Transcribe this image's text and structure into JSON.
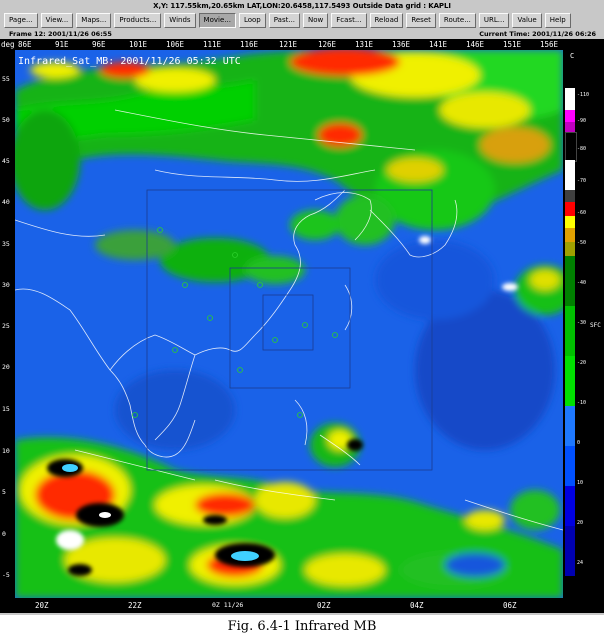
{
  "window": {
    "title": "X,Y: 117.55km,20.65km  LAT,LON:20.6458,117.5493  Outside Data grid : KAPLI"
  },
  "toolbar": {
    "buttons": [
      "Page...",
      "View...",
      "Maps...",
      "Products...",
      "Winds",
      "Movie...",
      "Loop",
      "Past...",
      "Now",
      "Fcast...",
      "Reload",
      "Reset",
      "Route...",
      "URL...",
      "Value",
      "Help"
    ]
  },
  "info": {
    "frame": "Frame 12: 2001/11/26 06:55",
    "current_time": "Current Time: 2001/11/26 06:26"
  },
  "map": {
    "deg_label": "deg",
    "longitudes": [
      "86E",
      "91E",
      "96E",
      "101E",
      "106E",
      "111E",
      "116E",
      "121E",
      "126E",
      "131E",
      "136E",
      "141E",
      "146E",
      "151E",
      "156E"
    ],
    "latitudes": [
      "55",
      "50",
      "45",
      "40",
      "35",
      "30",
      "25",
      "20",
      "15",
      "10",
      "5",
      "0",
      "-5"
    ],
    "product_label": "Infrared_Sat_MB: 2001/11/26 05:32 UTC",
    "time_ticks": [
      "20Z",
      "22Z",
      "0Z 11/26",
      "02Z",
      "04Z",
      "06Z"
    ]
  },
  "colorbar": {
    "unit": "C",
    "unit_right": "SFC",
    "labels": [
      "-110",
      "-90",
      "-80",
      "-70",
      "-60",
      "-50",
      "-40",
      "-30",
      "-20",
      "-10",
      "0",
      "10",
      "20",
      "24"
    ],
    "colors": [
      "#ffffff",
      "#ff00ff",
      "#c000c0",
      "#000000",
      "#ffffff",
      "#ff0000",
      "#e0a000",
      "#008000",
      "#00cc00",
      "#00dd00",
      "#1e78ff",
      "#0000ff",
      "#0000d0",
      "#0000a0"
    ]
  },
  "caption": "Fig. 6.4-1 Infrared MB"
}
